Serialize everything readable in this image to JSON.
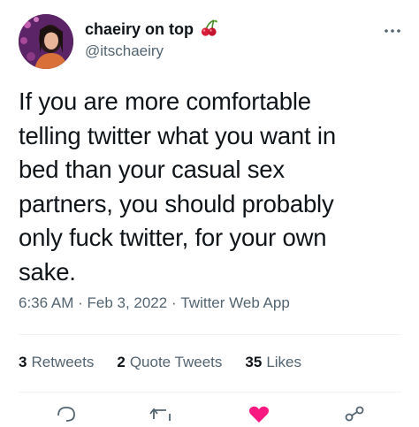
{
  "header": {
    "display_name": "chaeiry on top",
    "handle": "@itschaeiry",
    "name_emoji": "cherries-icon",
    "more_icon": "more-icon"
  },
  "tweet": {
    "lines": [
      "If you are more comfortable",
      "telling twitter what you want in",
      "bed than your casual sex",
      "partners, you should probably",
      "only fuck twitter, for your own",
      "sake."
    ]
  },
  "meta": {
    "time": "6:36 AM",
    "date": "Feb 3, 2022",
    "source": "Twitter Web App",
    "separator": " · "
  },
  "stats": {
    "retweets_count": "3",
    "retweets_label": "Retweets",
    "quotes_count": "2",
    "quotes_label": "Quote Tweets",
    "likes_count": "35",
    "likes_label": "Likes"
  },
  "colors": {
    "text": "#0f1419",
    "secondary": "#536471",
    "like_pink": "#f91880",
    "divider": "#eff3f4"
  }
}
